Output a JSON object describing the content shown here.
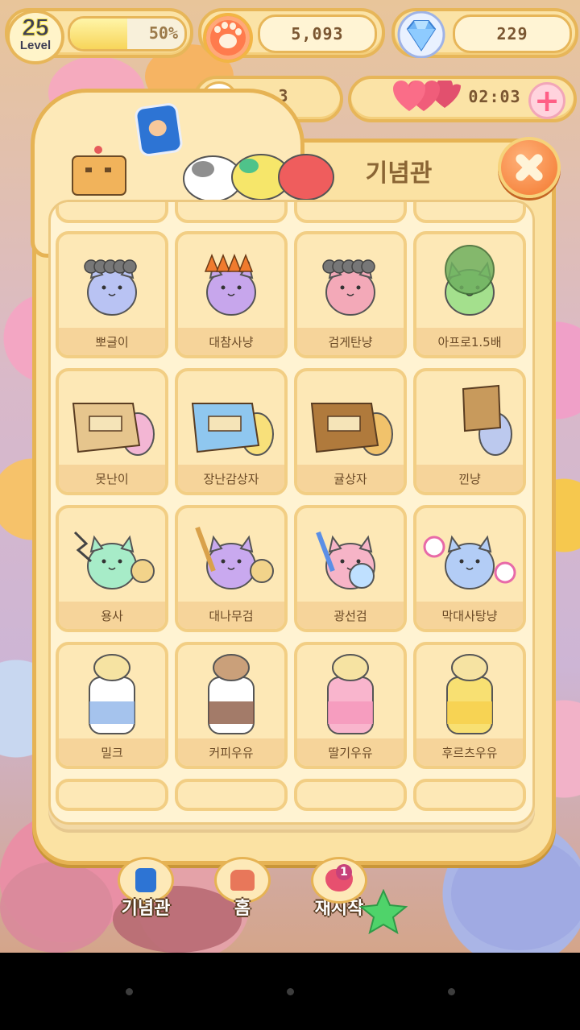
{
  "hud": {
    "level_value": "25",
    "level_caption": "Level",
    "xp_percent_text": "50%",
    "xp_progress": 0.5,
    "coins": "5,093",
    "gems": "229",
    "tickets": "3",
    "life_timer": "02:03",
    "plus_symbol": "+"
  },
  "panel": {
    "title": "기념관",
    "close_icon": "close-x-icon"
  },
  "collection": {
    "items": [
      {
        "label": "뽀글이",
        "color": "#b9c3f3",
        "prop": "curly-hair"
      },
      {
        "label": "대참사냥",
        "color": "#c7a6ec",
        "prop": "burnt-hair"
      },
      {
        "label": "검게탄냥",
        "color": "#f3a9b8",
        "prop": "curly-hair"
      },
      {
        "label": "아프로1.5배",
        "color": "#a4e08d",
        "prop": "afro"
      },
      {
        "label": "못난이",
        "color": "#f3b6d4",
        "prop": "box-pink"
      },
      {
        "label": "장난감상자",
        "color": "#f8e07a",
        "prop": "box-blue"
      },
      {
        "label": "귤상자",
        "color": "#f1c26b",
        "prop": "box-brown"
      },
      {
        "label": "낀냥",
        "color": "#bcc9ee",
        "prop": "box-stuck"
      },
      {
        "label": "용사",
        "color": "#a7ecc8",
        "prop": "lightning-sword"
      },
      {
        "label": "대나무검",
        "color": "#c9a9ef",
        "prop": "bamboo-sword"
      },
      {
        "label": "광선검",
        "color": "#f6b4c7",
        "prop": "light-saber"
      },
      {
        "label": "막대사탕냥",
        "color": "#b3cdf6",
        "prop": "lollipop"
      },
      {
        "label": "밀크",
        "color": "#8fb4e8",
        "prop": "milk-bottle"
      },
      {
        "label": "커피우유",
        "color": "#8c5a43",
        "prop": "coffee-bottle"
      },
      {
        "label": "딸기우유",
        "color": "#f597bb",
        "prop": "strawberry-bottle"
      },
      {
        "label": "후르츠우유",
        "color": "#f6cf4b",
        "prop": "fruit-bottle"
      }
    ]
  },
  "bottom": {
    "memorial_label": "기념관",
    "home_label": "홈",
    "restart_label": "재시작",
    "restart_badge": "1"
  }
}
